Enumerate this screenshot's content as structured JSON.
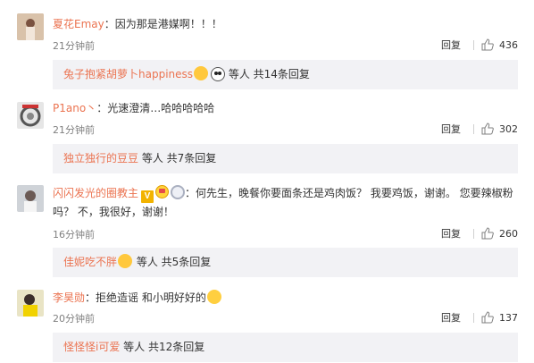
{
  "comments": [
    {
      "user": "夏花Emay",
      "text": "：因为那是港媒啊！！！",
      "time": "21分钟前",
      "reply_label": "回复",
      "likes": "436",
      "sub_user": "兔子抱紧胡萝卜happiness",
      "sub_text": " 等人 共14条回复"
    },
    {
      "user": "P1ano丶",
      "text": "：光速澄清…哈哈哈哈哈",
      "time": "21分钟前",
      "reply_label": "回复",
      "likes": "302",
      "sub_user": "独立独行的豆豆",
      "sub_text": " 等人 共7条回复"
    },
    {
      "user": "闪闪发光的圈教主",
      "text_line1": "：何先生，晚餐你要面条还是鸡肉饭？ 我要鸡饭，谢谢。 您要辣椒粉",
      "text_line2": "吗？ 不，我很好，谢谢！",
      "time": "16分钟前",
      "reply_label": "回复",
      "likes": "260",
      "sub_user": "佳妮吃不胖",
      "sub_text": " 等人 共5条回复"
    },
    {
      "user": "李昊勋",
      "text": "：拒绝造谣 和小明好好的",
      "time": "20分钟前",
      "reply_label": "回复",
      "likes": "137",
      "sub_user": "怪怪怪i可爱",
      "sub_text": " 等人 共12条回复"
    }
  ],
  "badges": {
    "v_label": "V"
  },
  "colors": {
    "username": "#eb7350",
    "subbox_bg": "#f2f2f5",
    "meta": "#808080"
  },
  "icons": [
    "thumbs-up-icon",
    "heart-eyes-emoji",
    "panda-emoji",
    "smile-emoji",
    "v-badge-icon",
    "crown-badge-icon",
    "ring-badge-icon"
  ]
}
